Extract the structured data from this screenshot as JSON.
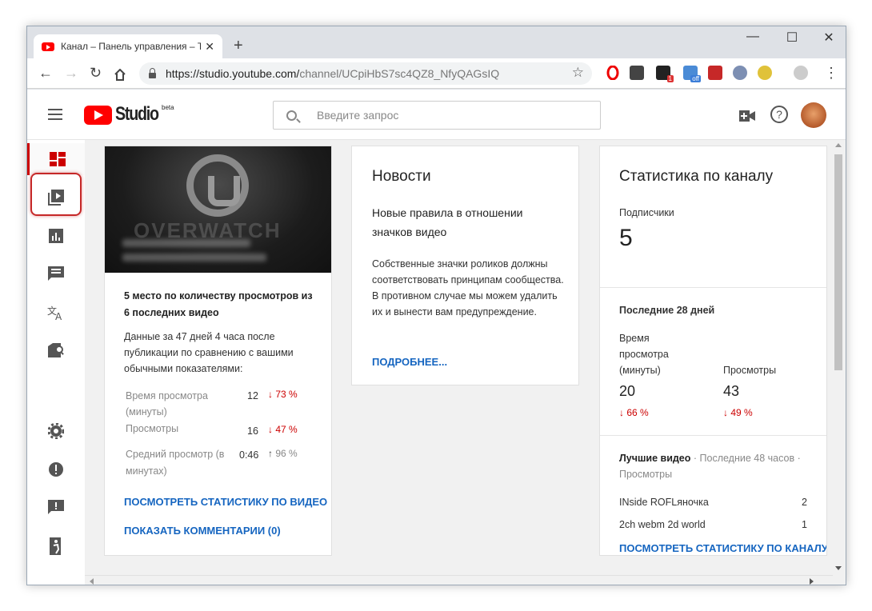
{
  "browser": {
    "tab_title": "Канал – Панель управления – T",
    "tab_close": "✕",
    "new_tab": "+",
    "url_base": "https://studio.youtube.com/",
    "url_path": "channel/UCpiHbS7sc4QZ8_NfyQAGsIQ",
    "ext_badge_1": "1",
    "ext_badge_off": "off"
  },
  "studio": {
    "logo_text": "Studio",
    "logo_beta": "beta",
    "search_placeholder": "Введите запрос"
  },
  "video_card": {
    "rank_text": "5 место по количеству просмотров из 6 последних видео",
    "description": "Данные за 47 дней 4 часа после публикации по сравнению с вашими обычными показателями:",
    "metrics": [
      {
        "label": "Время просмотра (минуты)",
        "value": "12",
        "change": "73 %",
        "direction": "down"
      },
      {
        "label": "Просмотры",
        "value": "16",
        "change": "47 %",
        "direction": "down"
      },
      {
        "label": "Средний просмотр (в минутах)",
        "value": "0:46",
        "change": "96 %",
        "direction": "up"
      }
    ],
    "link_stats": "ПОСМОТРЕТЬ СТАТИСТИКУ ПО ВИДЕО",
    "link_comments": "ПОКАЗАТЬ КОММЕНТАРИИ (0)",
    "thumb_text": "OVERWATCH"
  },
  "news_card": {
    "title": "Новости",
    "headline": "Новые правила в отношении значков видео",
    "body": "Собственные значки роликов должны соответствовать принципам сообщества. В противном случае мы можем удалить их и вынести вам предупреждение.",
    "link": "ПОДРОБНЕЕ..."
  },
  "stats_card": {
    "title": "Статистика по каналу",
    "subscribers_label": "Подписчики",
    "subscribers_value": "5",
    "period_label": "Последние 28 дней",
    "watch_time_label": "Время просмотра (минуты)",
    "watch_time_value": "20",
    "watch_time_change": "66 %",
    "views_label": "Просмотры",
    "views_value": "43",
    "views_change": "49 %",
    "top_videos_label": "Лучшие видео",
    "top_videos_meta": " · Последние 48 часов · Просмотры",
    "top_videos": [
      {
        "title": "INside ROFLяночка",
        "views": "2"
      },
      {
        "title": "2ch webm 2d world",
        "views": "1"
      }
    ],
    "link": "ПОСМОТРЕТЬ СТАТИСТИКУ ПО КАНАЛУ"
  },
  "icons": {
    "down_arrow": "↓",
    "up_arrow": "↑",
    "back": "←",
    "forward": "→",
    "reload": "↻",
    "star": "☆",
    "menu": "⋮",
    "minimize": "—",
    "maximize": "☐",
    "close": "✕",
    "help": "?"
  },
  "colors": {
    "accent_red": "#cc0000",
    "link_blue": "#1565c0",
    "youtube_red": "#ff0000"
  }
}
